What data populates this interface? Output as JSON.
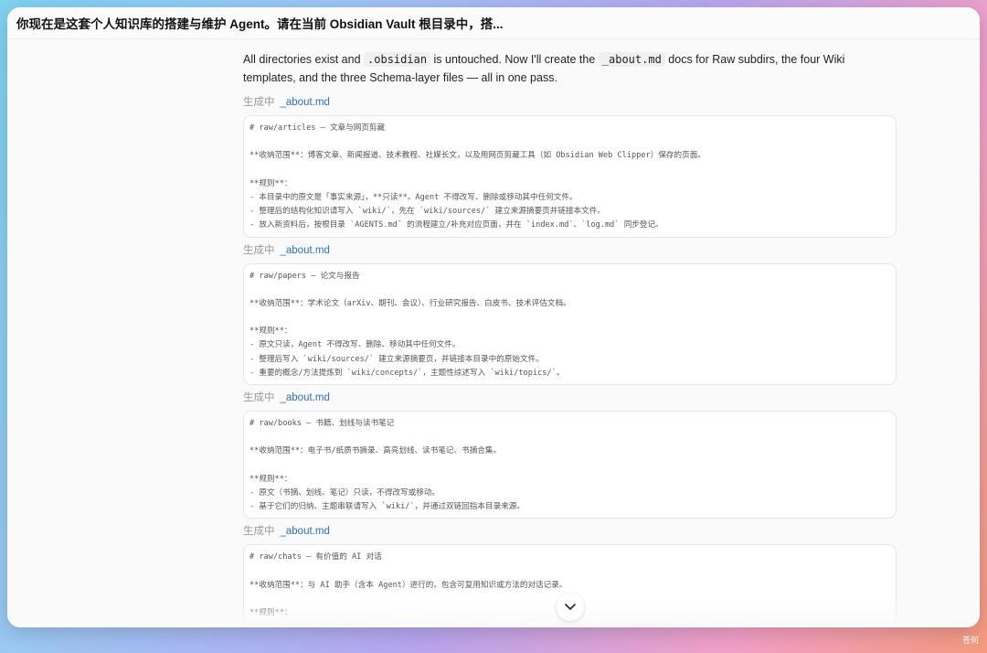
{
  "window": {
    "title": "你现在是这套个人知识库的搭建与维护 Agent。请在当前 Obsidian Vault 根目录中，搭..."
  },
  "intro": {
    "p1": "All directories exist and ",
    "code1": ".obsidian",
    "p2": " is untouched. Now I'll create the ",
    "code2": "_about.md",
    "p3": " docs for Raw subdirs, the four Wiki templates, and the three Schema-layer files — all in one pass."
  },
  "blocks": [
    {
      "label": "生成中",
      "file": "_about.md",
      "lines": [
        "# raw/articles — 文章与网页剪藏",
        "",
        "**收纳范围**：博客文章、新闻报道、技术教程、社媒长文，以及用网页剪藏工具（如 Obsidian Web Clipper）保存的页面。",
        "",
        "**规则**：",
        "- 本目录中的原文是「事实来源」，**只读**。Agent 不得改写、删除或移动其中任何文件。",
        "- 整理后的结构化知识请写入 `wiki/`，先在 `wiki/sources/` 建立来源摘要页并链接本文件。",
        "- 放入新资料后，按根目录 `AGENTS.md` 的流程建立/补充对应页面，并在 `index.md`、`log.md` 同步登记。"
      ]
    },
    {
      "label": "生成中",
      "file": "_about.md",
      "lines": [
        "# raw/papers — 论文与报告",
        "",
        "**收纳范围**：学术论文（arXiv、期刊、会议）、行业研究报告、白皮书、技术评估文档。",
        "",
        "**规则**：",
        "- 原文只读，Agent 不得改写、删除、移动其中任何文件。",
        "- 整理后写入 `wiki/sources/` 建立来源摘要页，并链接本目录中的原始文件。",
        "- 重要的概念/方法提炼到 `wiki/concepts/`，主题性综述写入 `wiki/topics/`。"
      ]
    },
    {
      "label": "生成中",
      "file": "_about.md",
      "lines": [
        "# raw/books — 书籍、划线与读书笔记",
        "",
        "**收纳范围**：电子书/纸质书摘录、高亮划线、读书笔记、书摘合集。",
        "",
        "**规则**：",
        "- 原文（书摘、划线、笔记）只读，不得改写或移动。",
        "- 基于它们的归纳、主题串联请写入 `wiki/`，并通过双链回指本目录来源。"
      ]
    },
    {
      "label": "生成中",
      "file": "_about.md",
      "lines": [
        "# raw/chats — 有价值的 AI 对话",
        "",
        "**收纳范围**：与 AI 助手（含本 Agent）进行的、包含可复用知识或方法的对话记录。",
        "",
        "**规则**："
      ]
    }
  ],
  "icons": {
    "scroll_down": "chevron-down-icon"
  },
  "watermark": "苍何"
}
